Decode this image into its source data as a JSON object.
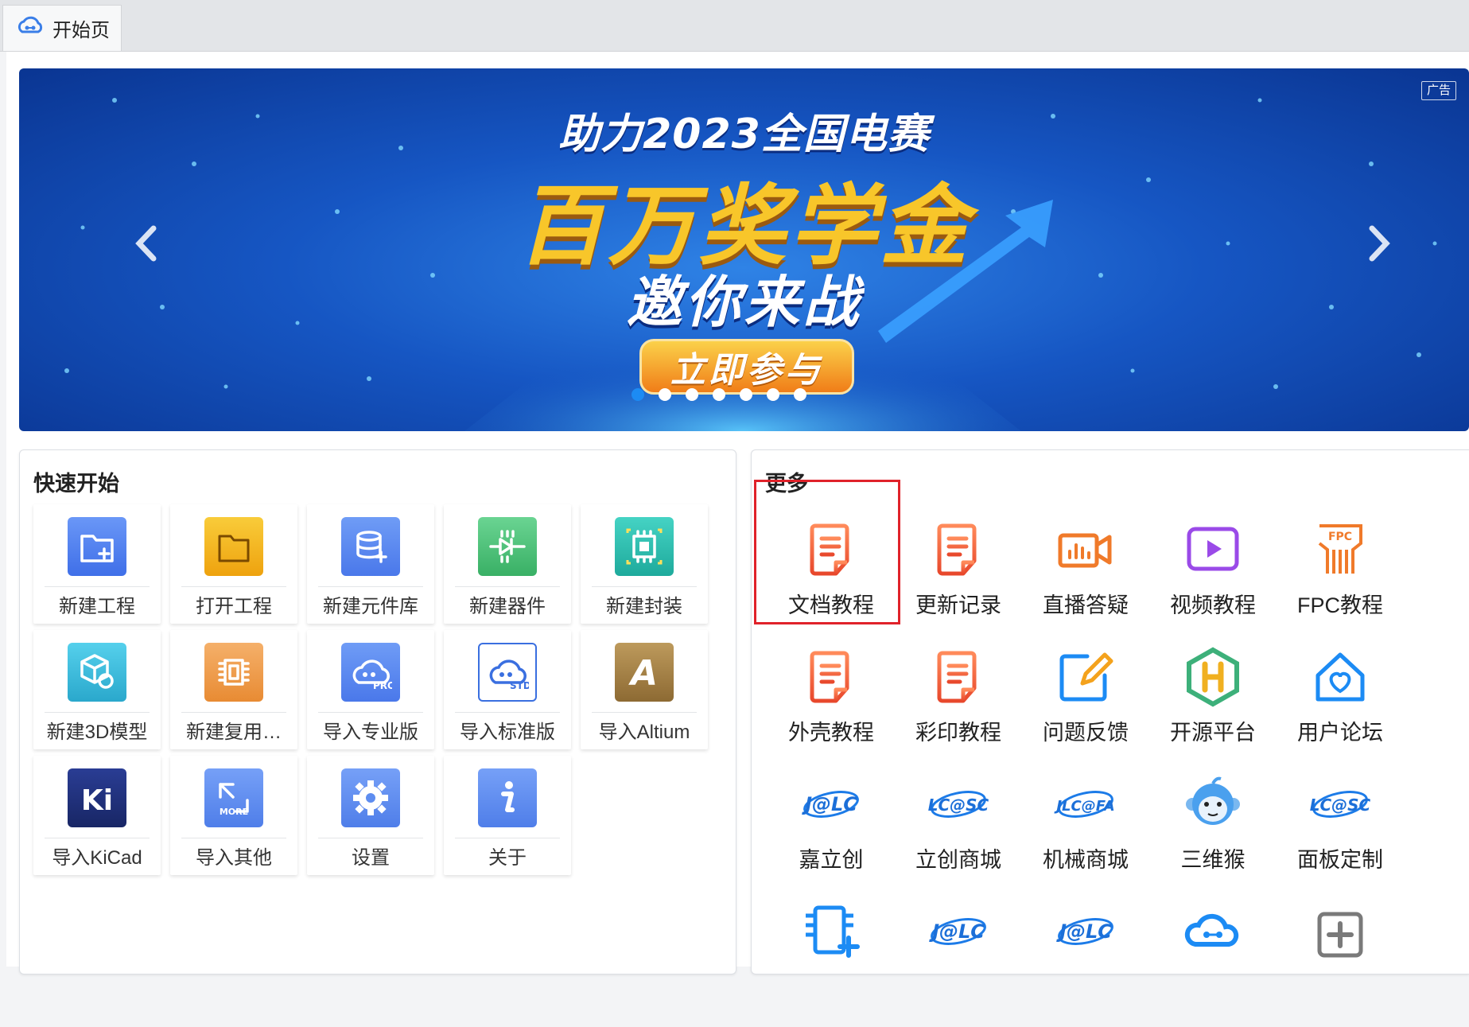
{
  "tab": {
    "label": "开始页",
    "icon": "cloud-link-icon"
  },
  "banner": {
    "ad_tag": "广告",
    "line1": "助力2023全国电赛",
    "line2": "百万奖学金",
    "line3": "邀你来战",
    "cta": "立即参与",
    "slide_count": 7,
    "active_slide": 1
  },
  "quick_start": {
    "title": "快速开始",
    "items": [
      {
        "label": "新建工程",
        "icon": "new-project-icon",
        "color": "#4a7ef3"
      },
      {
        "label": "打开工程",
        "icon": "open-folder-icon",
        "color": "#f2b316"
      },
      {
        "label": "新建元件库",
        "icon": "new-library-icon",
        "color": "#5889ee"
      },
      {
        "label": "新建器件",
        "icon": "new-component-icon",
        "color": "#4cc07a"
      },
      {
        "label": "新建封装",
        "icon": "new-footprint-icon",
        "color": "#2fc0b4"
      },
      {
        "label": "新建3D模型",
        "icon": "new-3d-model-icon",
        "color": "#34b9d8"
      },
      {
        "label": "新建复用…",
        "icon": "new-reuse-block-icon",
        "color": "#ef9a4a"
      },
      {
        "label": "导入专业版",
        "icon": "import-pro-icon",
        "color": "#5a86f0"
      },
      {
        "label": "导入标准版",
        "icon": "import-std-icon",
        "color": "#ffffff"
      },
      {
        "label": "导入Altium",
        "icon": "import-altium-icon",
        "color": "#a8844a"
      },
      {
        "label": "导入KiCad",
        "icon": "import-kicad-icon",
        "color": "#1f2f7a"
      },
      {
        "label": "导入其他",
        "icon": "import-more-icon",
        "color": "#5e8df0"
      },
      {
        "label": "设置",
        "icon": "settings-gear-icon",
        "color": "#5e8df0"
      },
      {
        "label": "关于",
        "icon": "about-info-icon",
        "color": "#5e8df0"
      }
    ]
  },
  "more": {
    "title": "更多",
    "items": [
      {
        "label": "文档教程",
        "icon": "document-tutorial-icon"
      },
      {
        "label": "更新记录",
        "icon": "update-log-icon"
      },
      {
        "label": "直播答疑",
        "icon": "live-qa-icon"
      },
      {
        "label": "视频教程",
        "icon": "video-tutorial-icon"
      },
      {
        "label": "FPC教程",
        "icon": "fpc-tutorial-icon"
      },
      {
        "label": "外壳教程",
        "icon": "enclosure-tutorial-icon"
      },
      {
        "label": "彩印教程",
        "icon": "color-print-tutorial-icon"
      },
      {
        "label": "问题反馈",
        "icon": "feedback-edit-icon"
      },
      {
        "label": "开源平台",
        "icon": "open-source-platform-icon"
      },
      {
        "label": "用户论坛",
        "icon": "user-forum-icon"
      },
      {
        "label": "嘉立创",
        "icon": "jlc-logo-icon",
        "logo_text": "J@LC"
      },
      {
        "label": "立创商城",
        "icon": "lcsc-logo-icon",
        "logo_text": "LC@SC"
      },
      {
        "label": "机械商城",
        "icon": "jlcfa-logo-icon",
        "logo_text": "JLC@FA"
      },
      {
        "label": "三维猴",
        "icon": "monkey-3d-icon"
      },
      {
        "label": "面板定制",
        "icon": "panel-custom-logo-icon",
        "logo_text": "LC@SC"
      },
      {
        "label": "",
        "icon": "chip-add-icon"
      },
      {
        "label": "",
        "icon": "jlc-logo-icon",
        "logo_text": "J@LC"
      },
      {
        "label": "",
        "icon": "jlc-logo-icon",
        "logo_text": "J@LC"
      },
      {
        "label": "",
        "icon": "cloud-link-icon"
      },
      {
        "label": "",
        "icon": "add-box-icon"
      }
    ]
  }
}
